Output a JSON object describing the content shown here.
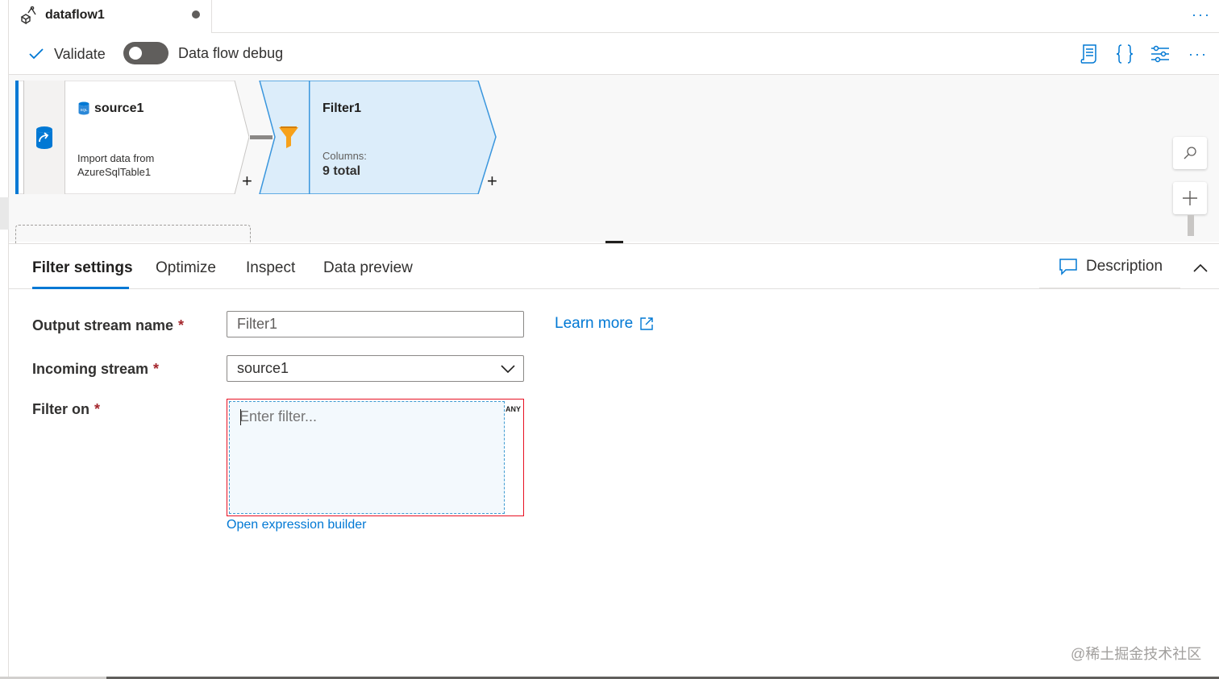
{
  "doc_tab": {
    "title": "dataflow1"
  },
  "toolbar": {
    "validate_label": "Validate",
    "debug_label": "Data flow debug",
    "debug_enabled": false
  },
  "canvas": {
    "source": {
      "title": "source1",
      "sub_line1": "Import data from",
      "sub_line2": "AzureSqlTable1",
      "badge": "SQL"
    },
    "filter": {
      "title": "Filter1",
      "columns_label": "Columns:",
      "columns_value": "9 total"
    },
    "add_symbol": "+"
  },
  "panel": {
    "tabs": [
      {
        "label": "Filter settings",
        "active": true
      },
      {
        "label": "Optimize",
        "active": false
      },
      {
        "label": "Inspect",
        "active": false
      },
      {
        "label": "Data preview",
        "active": false
      }
    ],
    "description_label": "Description"
  },
  "form": {
    "output_stream": {
      "label": "Output stream name",
      "value": "Filter1"
    },
    "incoming_stream": {
      "label": "Incoming stream",
      "value": "source1"
    },
    "filter_on": {
      "label": "Filter on",
      "placeholder": "Enter filter...",
      "type_tag": "ANY"
    },
    "required_mark": "*",
    "learn_more": "Learn more",
    "open_expression_builder": "Open expression builder"
  },
  "watermark": "@稀土掘金技术社区",
  "colors": {
    "accent": "#0078d4",
    "error": "#e81123",
    "filter_node": "#dcedfa"
  }
}
